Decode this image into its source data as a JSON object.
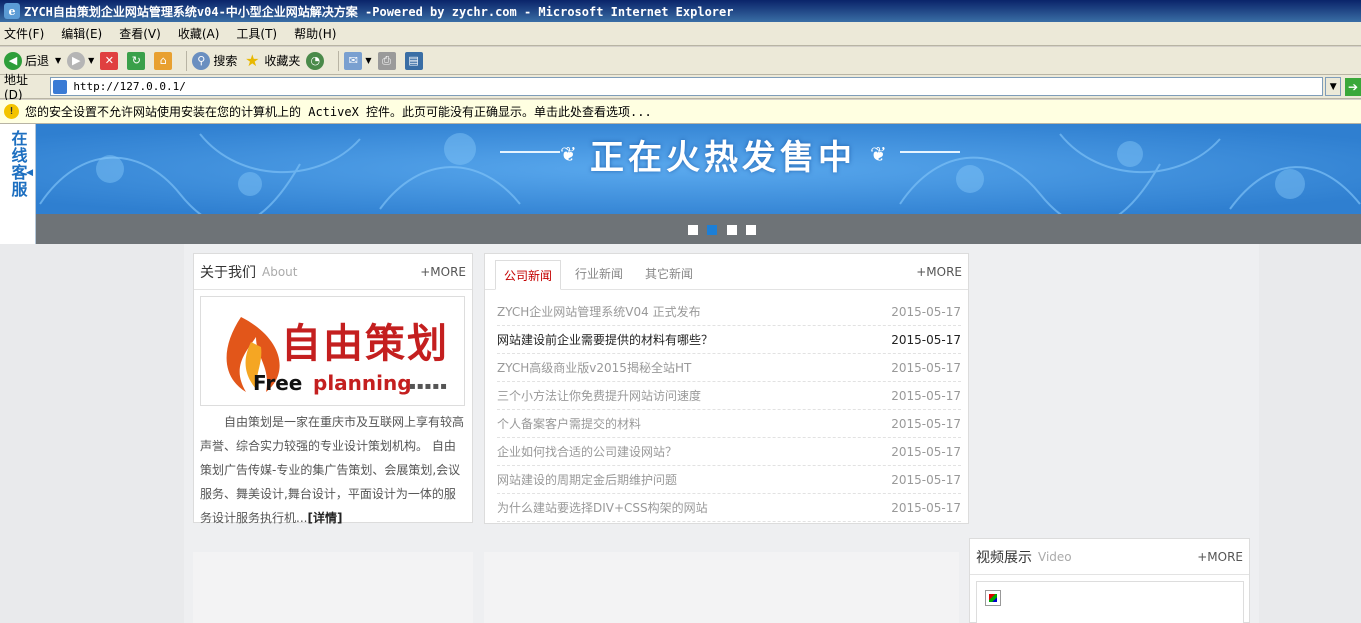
{
  "window": {
    "title": "ZYCH自由策划企业网站管理系统v04-中小型企业网站解决方案 -Powered by zychr.com - Microsoft Internet Explorer"
  },
  "menu": [
    "文件(F)",
    "编辑(E)",
    "查看(V)",
    "收藏(A)",
    "工具(T)",
    "帮助(H)"
  ],
  "toolbar": {
    "back": "后退",
    "search": "搜索",
    "favorites": "收藏夹"
  },
  "address": {
    "label": "地址(D)",
    "url": "http://127.0.0.1/"
  },
  "infobar": {
    "message": "您的安全设置不允许网站使用安装在您的计算机上的 ActiveX 控件。此页可能没有正确显示。单击此处查看选项..."
  },
  "banner": {
    "text": "正在火热发售中",
    "slides": 4,
    "active_slide": 2
  },
  "online_service": "在线客服",
  "about": {
    "title": "关于我们",
    "sub": "About",
    "more": "+MORE",
    "logo_cn": "自由策划",
    "logo_en_1": "Free",
    "logo_en_2": "planning",
    "text": "自由策划是一家在重庆市及互联网上享有较高声誉、综合实力较强的专业设计策划机构。 自由策划广告传媒-专业的集广告策划、会展策划,会议服务、舞美设计,舞台设计，平面设计为一体的服务设计服务执行机...",
    "detail": "[详情]"
  },
  "news": {
    "tabs": [
      "公司新闻",
      "行业新闻",
      "其它新闻"
    ],
    "active_tab": 0,
    "more": "+MORE",
    "items": [
      {
        "title": "ZYCH企业网站管理系统V04 正式发布",
        "date": "2015-05-17"
      },
      {
        "title": "网站建设前企业需要提供的材料有哪些？",
        "date": "2015-05-17"
      },
      {
        "title": "ZYCH高级商业版v2015揭秘全站HT",
        "date": "2015-05-17"
      },
      {
        "title": "三个小方法让你免费提升网站访问速度",
        "date": "2015-05-17"
      },
      {
        "title": "个人备案客户需提交的材料",
        "date": "2015-05-17"
      },
      {
        "title": "企业如何找合适的公司建设网站？",
        "date": "2015-05-17"
      },
      {
        "title": "网站建设的周期定金后期维护问题",
        "date": "2015-05-17"
      },
      {
        "title": "为什么建站要选择DIV+CSS构架的网站",
        "date": "2015-05-17"
      }
    ]
  },
  "video": {
    "title": "视频展示",
    "sub": "Video",
    "more": "+MORE"
  },
  "colors": {
    "banner_blue": "#3a8ee0",
    "active_tab_red": "#c40000",
    "dot_active": "#1d7fd6"
  }
}
